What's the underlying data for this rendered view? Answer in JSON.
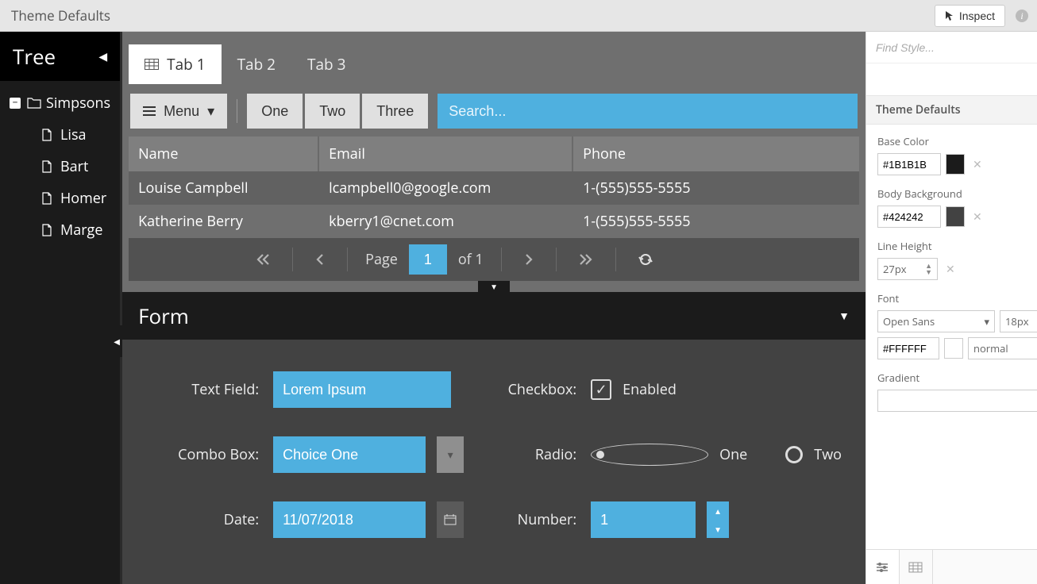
{
  "header": {
    "title": "Theme Defaults",
    "inspect_label": "Inspect"
  },
  "find": {
    "placeholder": "Find Style..."
  },
  "sidebar": {
    "title": "Tree",
    "root": "Simpsons",
    "items": [
      "Lisa",
      "Bart",
      "Homer",
      "Marge"
    ]
  },
  "tabs": {
    "items": [
      {
        "label": "Tab 1",
        "active": true
      },
      {
        "label": "Tab 2",
        "active": false
      },
      {
        "label": "Tab 3",
        "active": false
      }
    ]
  },
  "toolbar": {
    "menu_label": "Menu",
    "segments": [
      "One",
      "Two",
      "Three"
    ],
    "search_placeholder": "Search..."
  },
  "grid": {
    "columns": [
      "Name",
      "Email",
      "Phone"
    ],
    "rows": [
      {
        "name": "Louise Campbell",
        "email": "lcampbell0@google.com",
        "phone": "1-(555)555-5555"
      },
      {
        "name": "Katherine Berry",
        "email": "kberry1@cnet.com",
        "phone": "1-(555)555-5555"
      }
    ]
  },
  "paging": {
    "page_label": "Page",
    "current": "1",
    "of_label": "of 1"
  },
  "form": {
    "title": "Form",
    "text_field": {
      "label": "Text Field:",
      "value": "Lorem Ipsum"
    },
    "combo": {
      "label": "Combo Box:",
      "value": "Choice One"
    },
    "date": {
      "label": "Date:",
      "value": "11/07/2018"
    },
    "checkbox": {
      "label": "Checkbox:",
      "value_label": "Enabled",
      "checked": true
    },
    "radio": {
      "label": "Radio:",
      "options": [
        "One",
        "Two"
      ],
      "selected": 0
    },
    "number": {
      "label": "Number:",
      "value": "1"
    }
  },
  "theme_panel": {
    "title": "Theme Defaults",
    "base_color": {
      "label": "Base Color",
      "value": "#1B1B1B"
    },
    "body_bg": {
      "label": "Body Background",
      "value": "#424242"
    },
    "line_height": {
      "label": "Line Height",
      "value": "27px"
    },
    "font": {
      "label": "Font",
      "family": "Open Sans",
      "size": "18px",
      "color": "#FFFFFF",
      "weight": "normal"
    },
    "gradient": {
      "label": "Gradient",
      "value": ""
    }
  }
}
